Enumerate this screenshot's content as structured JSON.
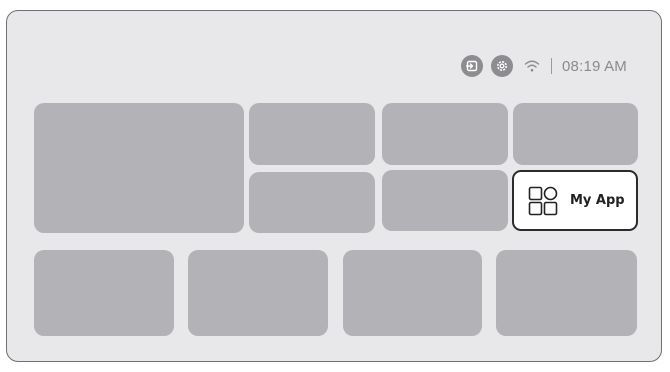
{
  "status_bar": {
    "input_icon": "input-source-icon",
    "settings_icon": "settings-gear-icon",
    "wifi_icon": "wifi-icon",
    "time": "08:19 AM"
  },
  "focused_tile": {
    "label": "My App",
    "icon": "apps-grid-icon"
  },
  "colors": {
    "screen_bg": "#e8e8ea",
    "tile": "#b3b2b6",
    "status_icon": "#8d8d91",
    "focus_border": "#2b2b2e"
  }
}
